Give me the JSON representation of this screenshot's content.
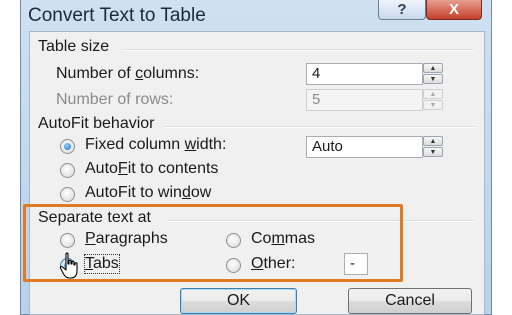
{
  "window": {
    "title": "Convert Text to Table",
    "help_symbol": "?",
    "close_symbol": "X"
  },
  "table_size": {
    "heading": "Table size",
    "columns_label": "Number of columns:",
    "columns_value": "4",
    "rows_label": "Number of rows:",
    "rows_value": "5"
  },
  "autofit": {
    "heading": "AutoFit behavior",
    "fixed_label": "Fixed column width:",
    "fixed_value": "Auto",
    "contents_label": "AutoFit to contents",
    "window_label": "AutoFit to window",
    "selected": "fixed"
  },
  "separate": {
    "heading": "Separate text at",
    "paragraphs_label": "Paragraphs",
    "commas_label": "Commas",
    "tabs_label": "Tabs",
    "other_label": "Other:",
    "other_value": "-",
    "selected": "tabs"
  },
  "buttons": {
    "ok": "OK",
    "cancel": "Cancel"
  },
  "colors": {
    "highlight": "#e07b22",
    "title_bar": "#b9d1ea",
    "close": "#c3412c"
  }
}
